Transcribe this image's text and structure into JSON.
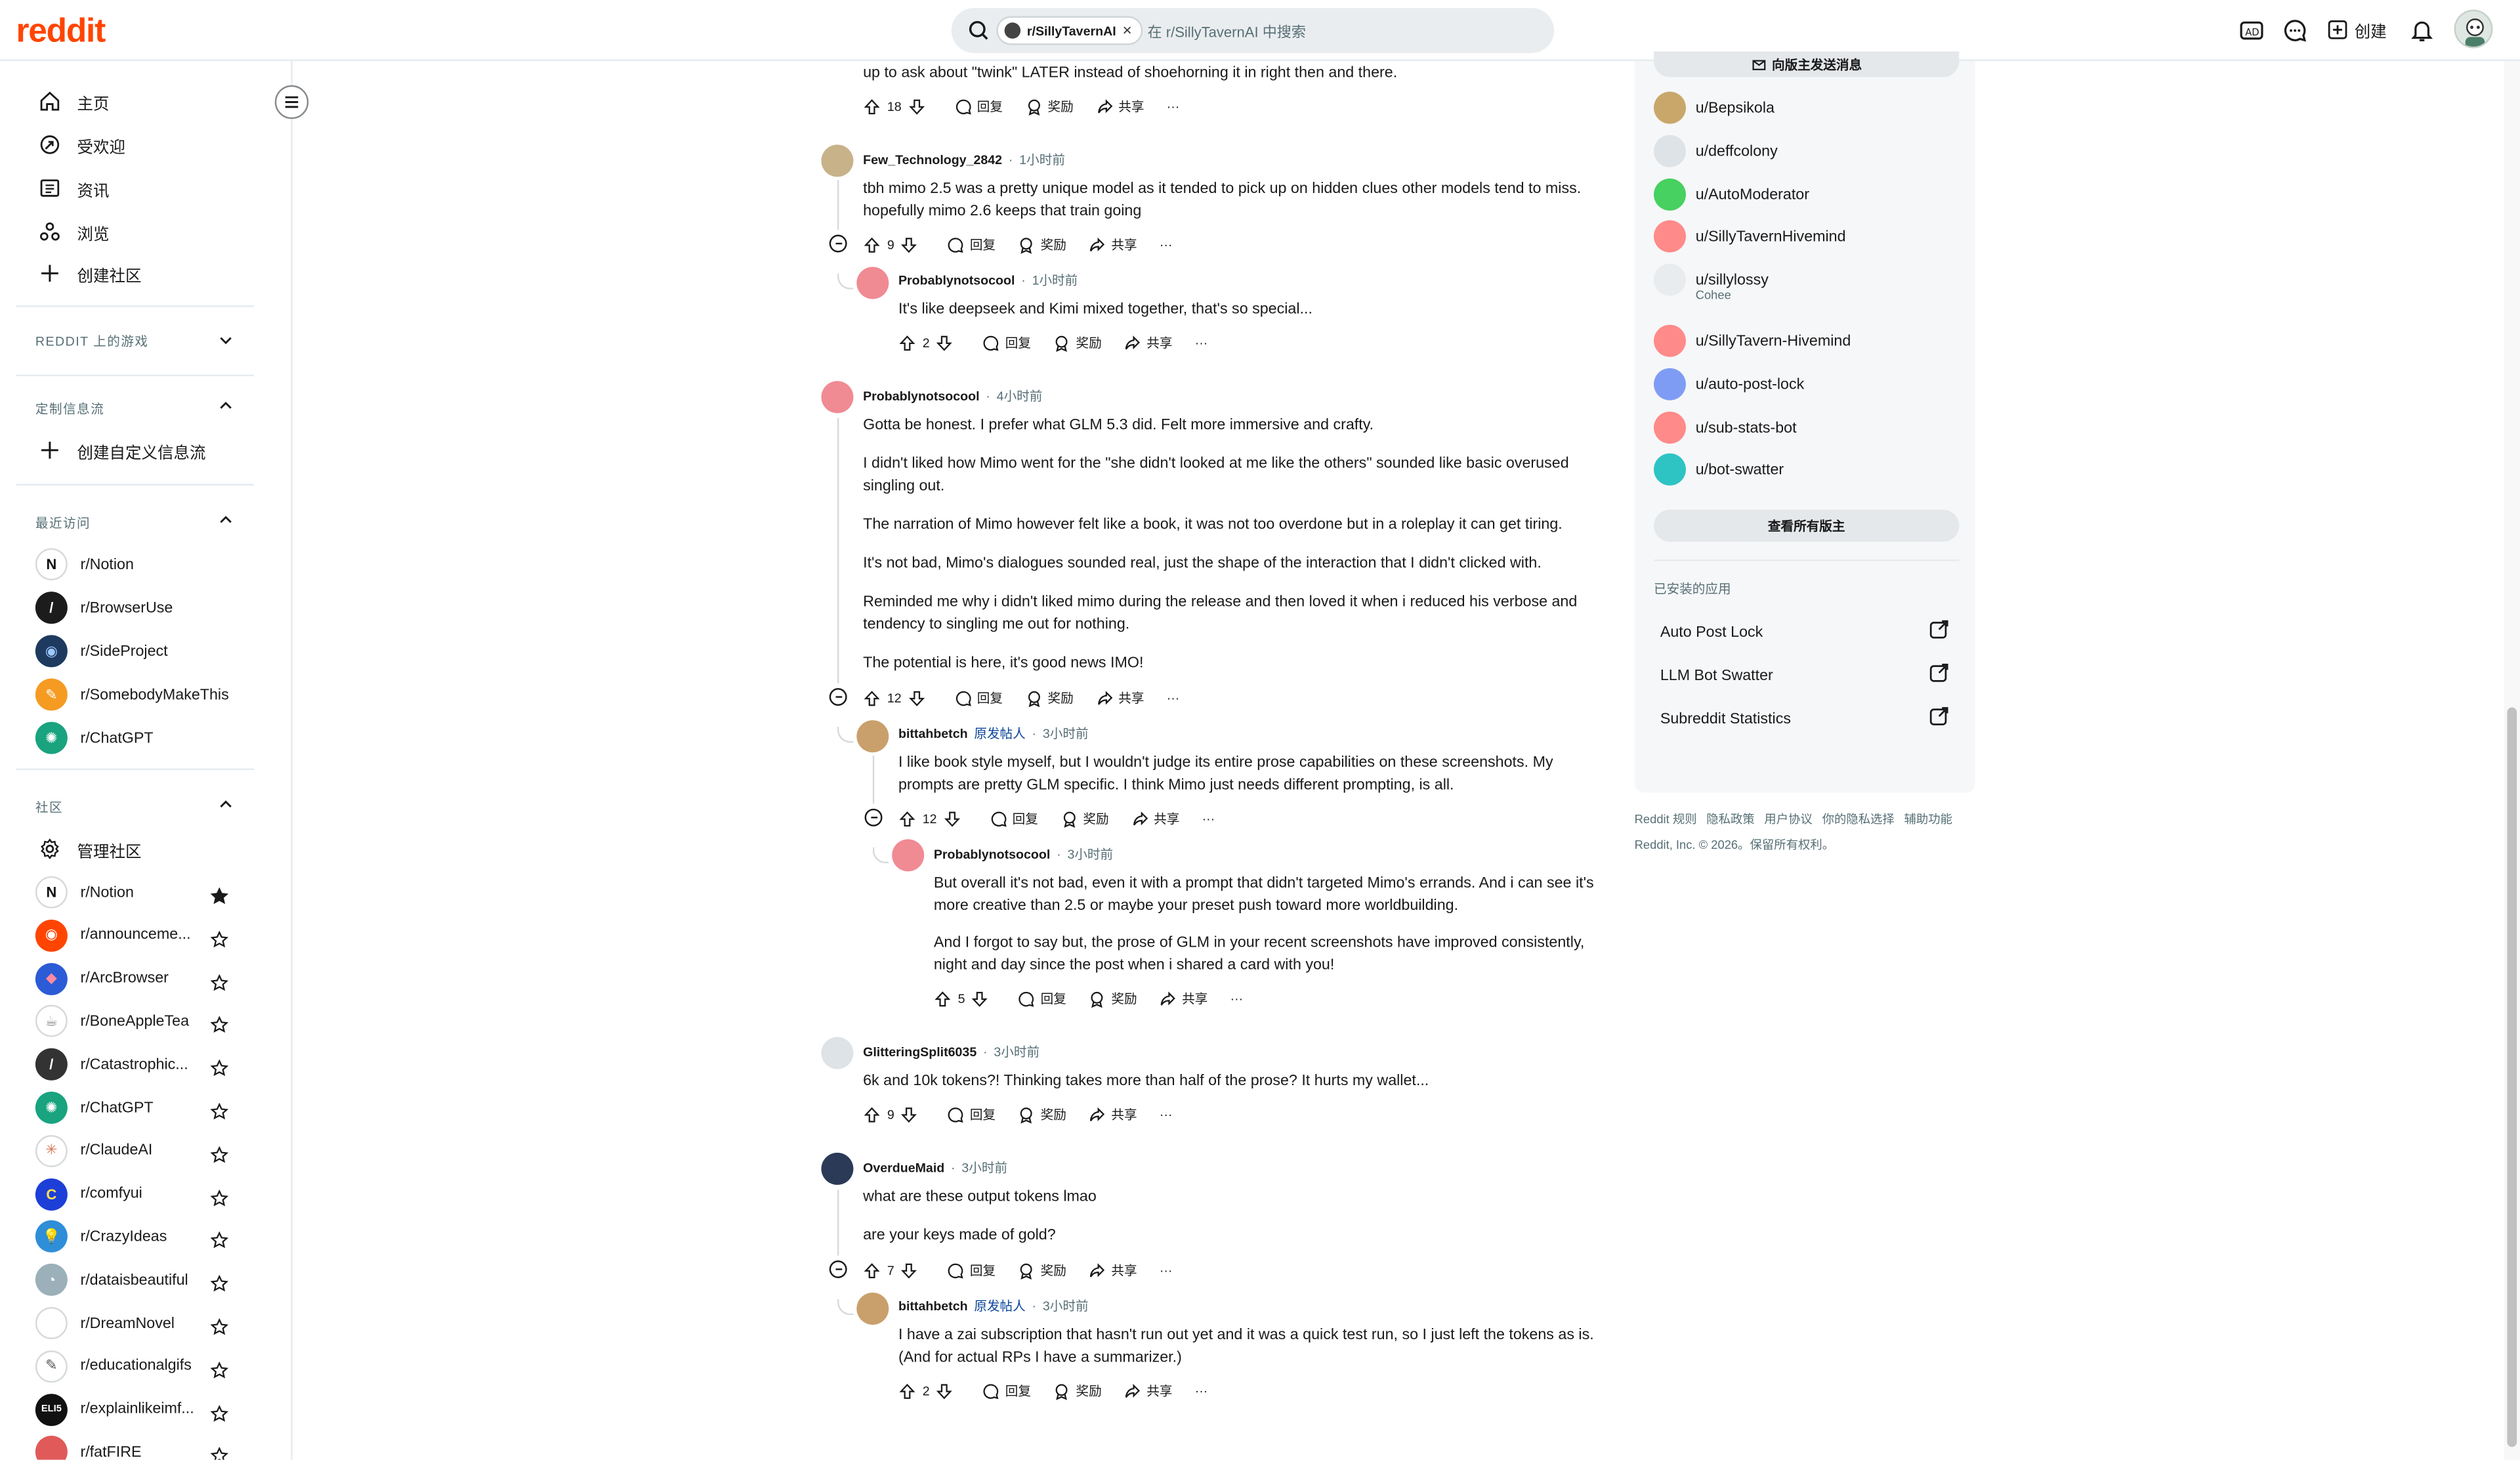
{
  "header": {
    "logo": "reddit",
    "search_chip": "r/SillyTavernAI",
    "search_placeholder": "在 r/SillyTavernAI 中搜索",
    "create_label": "创建"
  },
  "sidebar": {
    "nav": [
      {
        "label": "主页",
        "icon": "home-icon"
      },
      {
        "label": "受欢迎",
        "icon": "popular-icon"
      },
      {
        "label": "资讯",
        "icon": "news-icon"
      },
      {
        "label": "浏览",
        "icon": "explore-icon"
      },
      {
        "label": "创建社区",
        "icon": "plus-icon"
      }
    ],
    "games_title": "REDDIT 上的游戏",
    "custom_feeds_title": "定制信息流",
    "create_custom_feed": "创建自定义信息流",
    "recent_title": "最近访问",
    "recent": [
      {
        "name": "r/Notion",
        "color": "#ffffff",
        "mark": "N",
        "ink": "#111111"
      },
      {
        "name": "r/BrowserUse",
        "color": "#1c1c1c",
        "mark": "/",
        "ink": "#ffffff"
      },
      {
        "name": "r/SideProject",
        "color": "#1e3a5f",
        "mark": "◉",
        "ink": "#9ec9ff"
      },
      {
        "name": "r/SomebodyMakeThis",
        "color": "#f59b22",
        "mark": "✎",
        "ink": "#ffffff"
      },
      {
        "name": "r/ChatGPT",
        "color": "#19a37f",
        "mark": "✺",
        "ink": "#ffffff"
      }
    ],
    "communities_title": "社区",
    "manage_communities": "管理社区",
    "communities": [
      {
        "name": "r/Notion",
        "color": "#ffffff",
        "mark": "N",
        "ink": "#111111",
        "starred": true
      },
      {
        "name": "r/announceme...",
        "color": "#ff4500",
        "mark": "◉",
        "ink": "#ffffff",
        "starred": false
      },
      {
        "name": "r/ArcBrowser",
        "color": "#2c5bd6",
        "mark": "◆",
        "ink": "#ff8aa0",
        "starred": false
      },
      {
        "name": "r/BoneAppleTea",
        "color": "#ffffff",
        "mark": "☕",
        "ink": "#888888",
        "starred": false
      },
      {
        "name": "r/Catastrophic...",
        "color": "#333333",
        "mark": "/",
        "ink": "#ffffff",
        "starred": false
      },
      {
        "name": "r/ChatGPT",
        "color": "#19a37f",
        "mark": "✺",
        "ink": "#ffffff",
        "starred": false
      },
      {
        "name": "r/ClaudeAI",
        "color": "#ffffff",
        "mark": "✳",
        "ink": "#d97757",
        "starred": false
      },
      {
        "name": "r/comfyui",
        "color": "#1d3fd8",
        "mark": "C",
        "ink": "#ffe14d",
        "starred": false
      },
      {
        "name": "r/CrazyIdeas",
        "color": "#2f8ed8",
        "mark": "💡",
        "ink": "#ffe14d",
        "starred": false
      },
      {
        "name": "r/dataisbeautiful",
        "color": "#9bb0b8",
        "mark": "◔",
        "ink": "#ffffff",
        "starred": false
      },
      {
        "name": "r/DreamNovel",
        "color": "#ffffff",
        "mark": "",
        "ink": "#ffffff",
        "starred": false
      },
      {
        "name": "r/educationalgifs",
        "color": "#ffffff",
        "mark": "✎",
        "ink": "#555555",
        "starred": false
      },
      {
        "name": "r/explainlikeimf...",
        "color": "#111111",
        "mark": "ELI5",
        "ink": "#ffffff",
        "starred": false
      },
      {
        "name": "r/fatFIRE",
        "color": "#e05a5a",
        "mark": "",
        "ink": "#ffffff",
        "starred": false
      }
    ]
  },
  "comments": [
    {
      "id": "c0",
      "text": "up to ask about \"twink\" LATER instead of shoehorning it in right then and there.",
      "votes": "18"
    },
    {
      "id": "c1",
      "user": "Few_Technology_2842",
      "time": "1小时前",
      "text": "tbh mimo 2.5 was a pretty unique model as it tended to pick up on hidden clues other models tend to miss. hopefully mimo 2.6 keeps that train going",
      "votes": "9"
    },
    {
      "id": "c2",
      "user": "Probablynotsocool",
      "time": "1小时前",
      "text": "It's like deepseek and Kimi mixed together, that's so special...",
      "votes": "2"
    },
    {
      "id": "c3",
      "user": "Probablynotsocool",
      "time": "4小时前",
      "paras": [
        "Gotta be honest. I prefer what GLM 5.3 did. Felt more immersive and crafty.",
        "I didn't liked how Mimo went for the \"she didn't looked at me like the others\" sounded like basic overused singling out.",
        "The narration of Mimo however felt like a book, it was not too overdone but in a roleplay it can get tiring.",
        "It's not bad, Mimo's dialogues sounded real, just the shape of the interaction that I didn't clicked with.",
        "Reminded me why i didn't liked mimo during the release and then loved it when i reduced his verbose and tendency to singling me out for nothing.",
        "The potential is here, it's good news IMO!"
      ],
      "votes": "12"
    },
    {
      "id": "c4",
      "user": "bittahbetch",
      "op": "原发帖人",
      "time": "3小时前",
      "text": "I like book style myself, but I wouldn't judge its entire prose capabilities on these screenshots. My prompts are pretty GLM specific. I think Mimo just needs different prompting, is all.",
      "votes": "12"
    },
    {
      "id": "c5",
      "user": "Probablynotsocool",
      "time": "3小时前",
      "paras": [
        "But overall it's not bad, even it with a prompt that didn't targeted Mimo's errands. And i can see it's more creative than 2.5 or maybe your preset push toward more worldbuilding.",
        "And I forgot to say but, the prose of GLM in your recent screenshots have improved consistently, night and day since the post when i shared a card with you!"
      ],
      "votes": "5"
    },
    {
      "id": "c6",
      "user": "GlitteringSplit6035",
      "time": "3小时前",
      "text": "6k and 10k tokens?! Thinking takes more than half of the prose? It hurts my wallet...",
      "votes": "9"
    },
    {
      "id": "c7",
      "user": "OverdueMaid",
      "time": "3小时前",
      "paras": [
        "what are these output tokens lmao",
        "are your keys made of gold?"
      ],
      "votes": "7"
    },
    {
      "id": "c8",
      "user": "bittahbetch",
      "op": "原发帖人",
      "time": "3小时前",
      "text": "I have a zai subscription that hasn't run out yet and it was a quick test run, so I just left the tokens as is. (And for actual RPs I have a summarizer.)",
      "votes": "2"
    }
  ],
  "actions": {
    "reply": "回复",
    "award": "奖励",
    "share": "共享",
    "more": "···"
  },
  "right": {
    "message_mods": "向版主发送消息",
    "mods": [
      {
        "name": "u/Bepsikola",
        "color": "#c9a76b"
      },
      {
        "name": "u/deffcolony",
        "color": "#dde3e6"
      },
      {
        "name": "u/AutoModerator",
        "color": "#46d160"
      },
      {
        "name": "u/SillyTavernHivemind",
        "color": "#ff8a8a"
      },
      {
        "name": "u/sillylossy",
        "color": "#e9ecee",
        "flair": "Cohee"
      },
      {
        "name": "u/SillyTavern-Hivemind",
        "color": "#ff8a8a"
      },
      {
        "name": "u/auto-post-lock",
        "color": "#7f9cf5"
      },
      {
        "name": "u/sub-stats-bot",
        "color": "#ff8a8a"
      },
      {
        "name": "u/bot-swatter",
        "color": "#2ec4c4"
      }
    ],
    "view_all_mods": "查看所有版主",
    "apps_title": "已安装的应用",
    "apps": [
      "Auto Post Lock",
      "LLM Bot Swatter",
      "Subreddit Statistics"
    ],
    "footer_links": [
      "Reddit 规则",
      "隐私政策",
      "用户协议",
      "你的隐私选择",
      "辅助功能"
    ],
    "copyright": "Reddit, Inc. © 2026。保留所有权利。"
  }
}
